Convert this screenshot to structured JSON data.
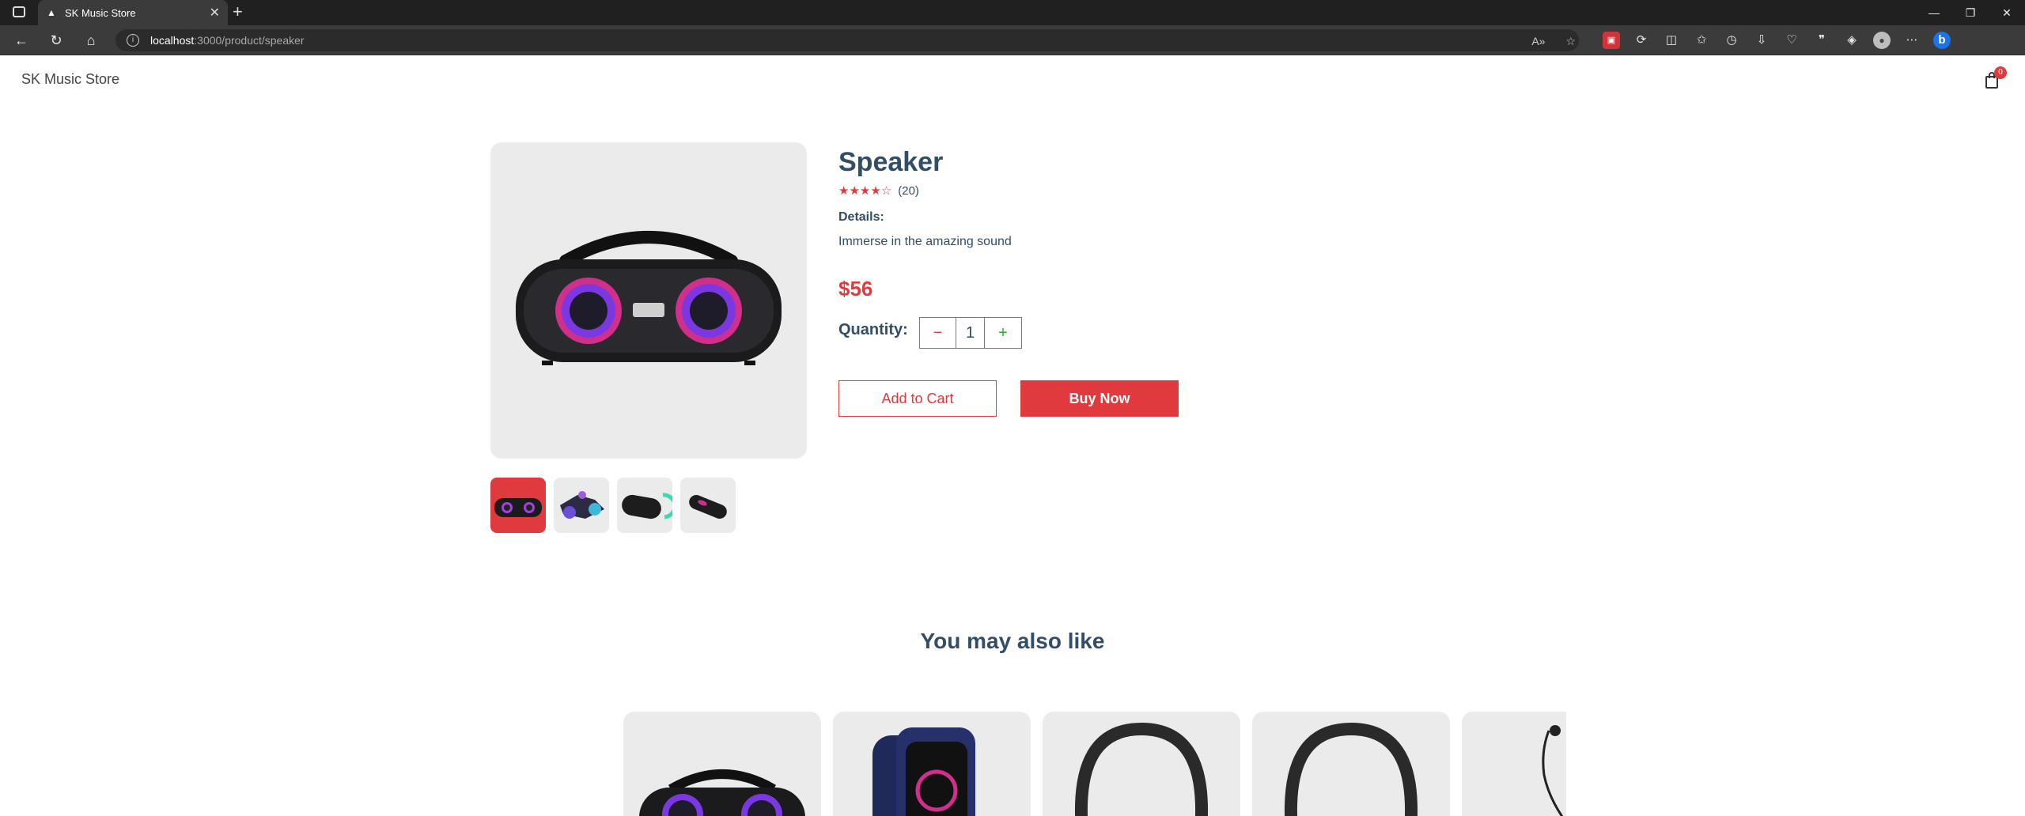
{
  "browser": {
    "tab_title": "SK Music Store",
    "new_tab_symbol": "+",
    "close_symbol": "✕",
    "url_host": "localhost",
    "url_path": ":3000/product/speaker",
    "window_controls": [
      "—",
      "❐",
      "✕"
    ]
  },
  "site": {
    "brand": "SK Music Store",
    "cart_count": "0"
  },
  "product": {
    "name": "Speaker",
    "rating": 4,
    "rating_max": 5,
    "stars": "★★★★☆",
    "review_count": "(20)",
    "details_heading": "Details:",
    "details_text": "Immerse in the amazing sound",
    "price": "$56",
    "quantity_label": "Quantity:",
    "quantity_minus": "−",
    "quantity_value": "1",
    "quantity_plus": "+",
    "add_to_cart": "Add to Cart",
    "buy_now": "Buy Now",
    "thumbnails": [
      "speaker-front",
      "speaker-wheel",
      "speaker-tube-dark",
      "speaker-tube-light"
    ]
  },
  "related": {
    "heading": "You may also like",
    "items": [
      "speaker",
      "smartwatch",
      "neckband",
      "neckband",
      "earphones"
    ]
  },
  "colors": {
    "accent": "#e03a3e",
    "text": "#324d67",
    "image_bg": "#ebebeb"
  }
}
